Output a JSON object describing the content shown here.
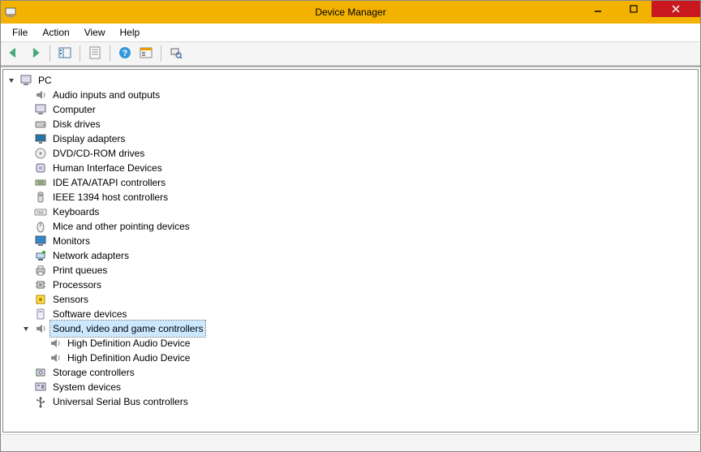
{
  "window": {
    "title": "Device Manager"
  },
  "menu": {
    "items": [
      "File",
      "Action",
      "View",
      "Help"
    ]
  },
  "toolbar": {
    "buttons": [
      {
        "name": "nav-back-button",
        "icon": "arrow-left"
      },
      {
        "name": "nav-forward-button",
        "icon": "arrow-right"
      },
      {
        "sep": true
      },
      {
        "name": "show-hide-console-tree-button",
        "icon": "console-tree"
      },
      {
        "sep": true
      },
      {
        "name": "properties-button",
        "icon": "properties"
      },
      {
        "sep": true
      },
      {
        "name": "help-button",
        "icon": "help"
      },
      {
        "name": "view-button",
        "icon": "view"
      },
      {
        "sep": true
      },
      {
        "name": "scan-hardware-button",
        "icon": "scan"
      }
    ]
  },
  "tree": {
    "root": {
      "label": "PC",
      "icon": "computer",
      "expanded": true,
      "children": [
        {
          "label": "Audio inputs and outputs",
          "icon": "speaker",
          "expanded": false
        },
        {
          "label": "Computer",
          "icon": "computer",
          "expanded": false
        },
        {
          "label": "Disk drives",
          "icon": "disk",
          "expanded": false
        },
        {
          "label": "Display adapters",
          "icon": "display",
          "expanded": false
        },
        {
          "label": "DVD/CD-ROM drives",
          "icon": "cdrom",
          "expanded": false
        },
        {
          "label": "Human Interface Devices",
          "icon": "hid",
          "expanded": false
        },
        {
          "label": "IDE ATA/ATAPI controllers",
          "icon": "ide",
          "expanded": false
        },
        {
          "label": "IEEE 1394 host controllers",
          "icon": "firewire",
          "expanded": false
        },
        {
          "label": "Keyboards",
          "icon": "keyboard",
          "expanded": false
        },
        {
          "label": "Mice and other pointing devices",
          "icon": "mouse",
          "expanded": false
        },
        {
          "label": "Monitors",
          "icon": "monitor",
          "expanded": false
        },
        {
          "label": "Network adapters",
          "icon": "network",
          "expanded": false
        },
        {
          "label": "Print queues",
          "icon": "printer",
          "expanded": false
        },
        {
          "label": "Processors",
          "icon": "cpu",
          "expanded": false
        },
        {
          "label": "Sensors",
          "icon": "sensor",
          "expanded": false
        },
        {
          "label": "Software devices",
          "icon": "software",
          "expanded": false
        },
        {
          "label": "Sound, video and game controllers",
          "icon": "speaker",
          "expanded": true,
          "selected": true,
          "children": [
            {
              "label": "High Definition Audio Device",
              "icon": "speaker"
            },
            {
              "label": "High Definition Audio Device",
              "icon": "speaker"
            }
          ]
        },
        {
          "label": "Storage controllers",
          "icon": "storage",
          "expanded": false
        },
        {
          "label": "System devices",
          "icon": "system",
          "expanded": false
        },
        {
          "label": "Universal Serial Bus controllers",
          "icon": "usb",
          "expanded": false
        }
      ]
    }
  }
}
